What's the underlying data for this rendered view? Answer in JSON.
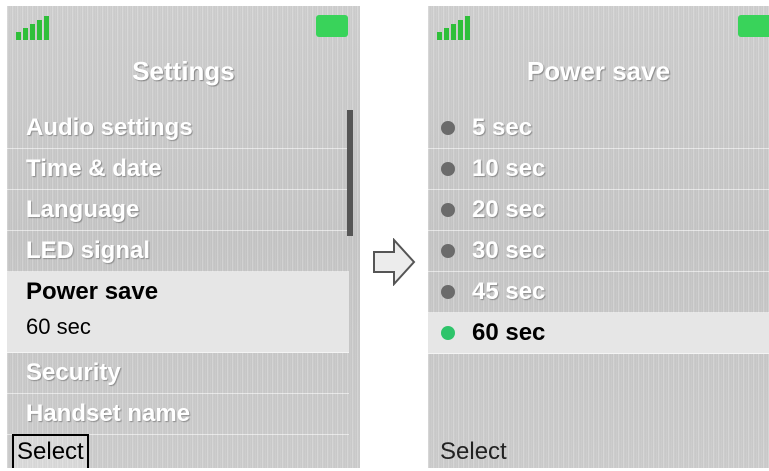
{
  "left_screen": {
    "title": "Settings",
    "items": [
      {
        "label": "Audio settings"
      },
      {
        "label": "Time & date"
      },
      {
        "label": "Language"
      },
      {
        "label": "LED signal"
      },
      {
        "label": "Power save",
        "value": "60 sec",
        "selected": true
      },
      {
        "label": "Security"
      },
      {
        "label": "Handset name"
      }
    ],
    "softkey": "Select",
    "icons": [
      "signal-icon",
      "battery-icon"
    ]
  },
  "right_screen": {
    "title": "Power save",
    "options": [
      "5 sec",
      "10 sec",
      "20 sec",
      "30 sec",
      "45 sec",
      "60 sec"
    ],
    "selected_option": "60 sec",
    "softkey": "Select",
    "icons": [
      "signal-icon",
      "battery-icon"
    ]
  },
  "transition_icon": "right-arrow-icon",
  "colors": {
    "accent": "#2ec46a",
    "battery": "#39d35a",
    "background": "#c9c9c9"
  }
}
